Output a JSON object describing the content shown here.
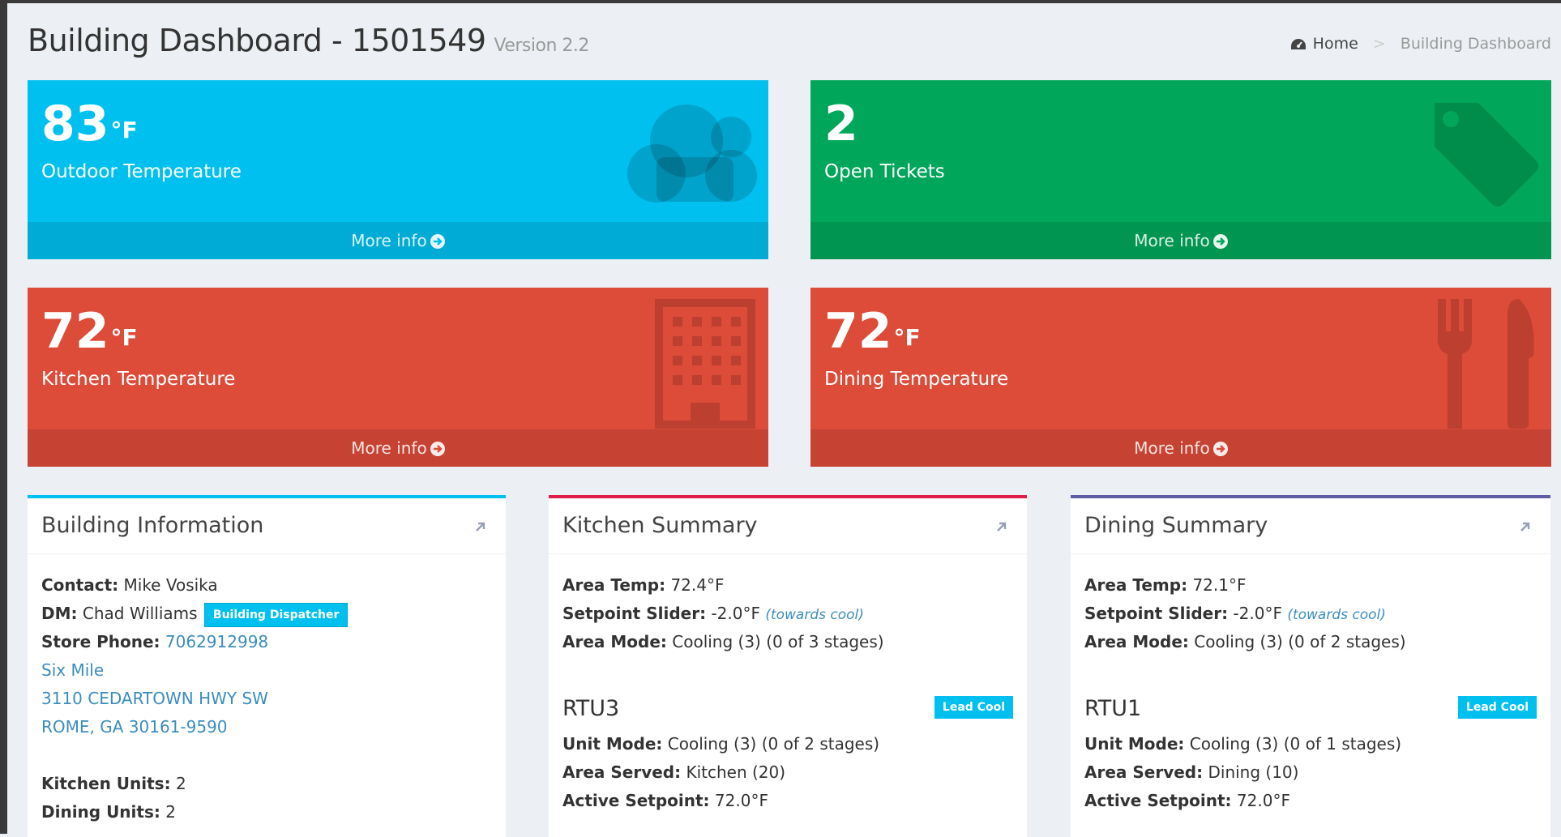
{
  "header": {
    "title": "Building Dashboard - 1501549",
    "version": "Version 2.2",
    "breadcrumb": {
      "home": "Home",
      "current": "Building Dashboard"
    }
  },
  "tiles": [
    {
      "value": "83",
      "unit": "°F",
      "label": "Outdoor Temperature",
      "footer": "More info",
      "color": "#00c0ef",
      "icon": "cloud-icon"
    },
    {
      "value": "2",
      "unit": "",
      "label": "Open Tickets",
      "footer": "More info",
      "color": "#00a65a",
      "icon": "tag-icon"
    },
    {
      "value": "72",
      "unit": "°F",
      "label": "Kitchen Temperature",
      "footer": "More info",
      "color": "#dd4b39",
      "icon": "building-icon"
    },
    {
      "value": "72",
      "unit": "°F",
      "label": "Dining Temperature",
      "footer": "More info",
      "color": "#dd4b39",
      "icon": "cutlery-icon"
    }
  ],
  "building": {
    "title": "Building Information",
    "contact_label": "Contact:",
    "contact": "Mike Vosika",
    "dm_label": "DM:",
    "dm": "Chad Williams",
    "dm_badge": "Building Dispatcher",
    "phone_label": "Store Phone:",
    "phone": "7062912998",
    "store_name": "Six Mile",
    "address1": "3110 CEDARTOWN HWY SW",
    "address2": "ROME, GA 30161-9590",
    "kitchen_units_label": "Kitchen Units:",
    "kitchen_units": "2",
    "dining_units_label": "Dining Units:",
    "dining_units": "2"
  },
  "kitchen": {
    "title": "Kitchen Summary",
    "area_temp_label": "Area Temp:",
    "area_temp": "72.4°F",
    "setpoint_label": "Setpoint Slider:",
    "setpoint": "-2.0°F",
    "setpoint_note": "(towards cool)",
    "area_mode_label": "Area Mode:",
    "area_mode": "Cooling (3) (0 of 3 stages)",
    "unit": {
      "name": "RTU3",
      "badge": "Lead Cool",
      "unit_mode_label": "Unit Mode:",
      "unit_mode": "Cooling (3) (0 of 2 stages)",
      "area_served_label": "Area Served:",
      "area_served": "Kitchen (20)",
      "active_setpoint_label": "Active Setpoint:",
      "active_setpoint": "72.0°F"
    }
  },
  "dining": {
    "title": "Dining Summary",
    "area_temp_label": "Area Temp:",
    "area_temp": "72.1°F",
    "setpoint_label": "Setpoint Slider:",
    "setpoint": "-2.0°F",
    "setpoint_note": "(towards cool)",
    "area_mode_label": "Area Mode:",
    "area_mode": "Cooling (3) (0 of 2 stages)",
    "unit": {
      "name": "RTU1",
      "badge": "Lead Cool",
      "unit_mode_label": "Unit Mode:",
      "unit_mode": "Cooling (3) (0 of 1 stages)",
      "area_served_label": "Area Served:",
      "area_served": "Dining (10)",
      "active_setpoint_label": "Active Setpoint:",
      "active_setpoint": "72.0°F"
    }
  },
  "colors": {
    "aqua": "#00c0ef",
    "green": "#00a65a",
    "red": "#dd4b39",
    "link": "#3c8dbc",
    "background": "#ecf0f5"
  }
}
